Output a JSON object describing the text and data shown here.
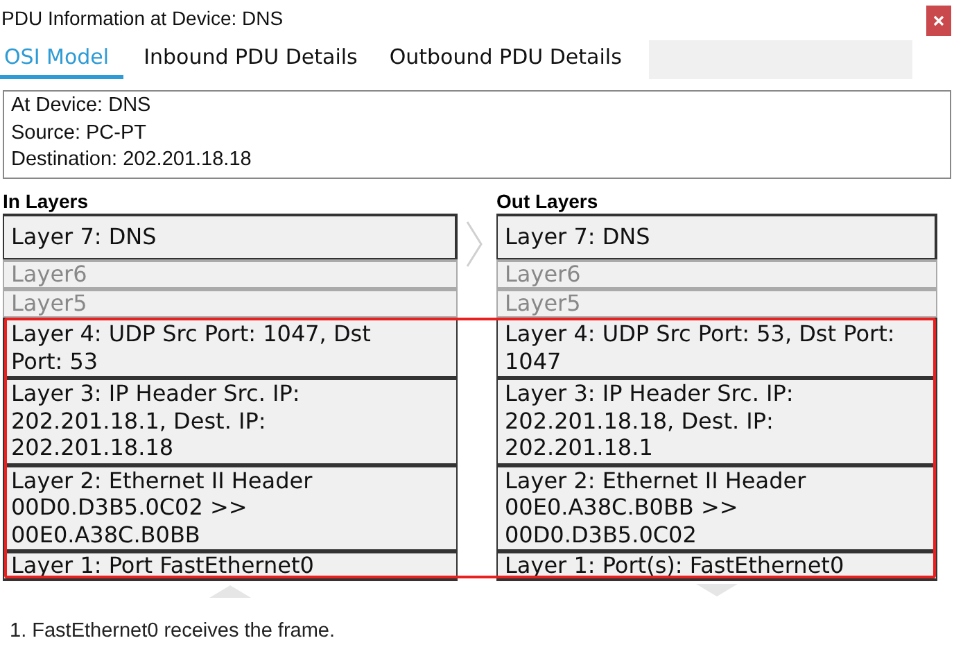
{
  "window": {
    "title": "PDU Information at Device: DNS"
  },
  "tabs": [
    {
      "label": "OSI Model",
      "selected": true
    },
    {
      "label": "Inbound PDU Details",
      "selected": false
    },
    {
      "label": "Outbound PDU Details",
      "selected": false
    }
  ],
  "info": [
    "At Device: DNS",
    "Source: PC-PT",
    "Destination: 202.201.18.18"
  ],
  "in_layers": {
    "heading": "In Layers",
    "layers": [
      {
        "text": "Layer 7: DNS",
        "disabled": false
      },
      {
        "text": "Layer6",
        "disabled": true
      },
      {
        "text": "Layer5",
        "disabled": true
      },
      {
        "text": "Layer 4: UDP Src Port: 1047, Dst Port: 53",
        "disabled": false
      },
      {
        "text": "Layer 3: IP Header Src. IP: 202.201.18.1, Dest. IP: 202.201.18.18",
        "disabled": false
      },
      {
        "text": "Layer 2: Ethernet II Header 00D0.D3B5.0C02 >> 00E0.A38C.B0BB",
        "disabled": false
      },
      {
        "text": "Layer 1: Port FastEthernet0",
        "disabled": false
      }
    ]
  },
  "out_layers": {
    "heading": "Out Layers",
    "layers": [
      {
        "text": "Layer 7: DNS",
        "disabled": false
      },
      {
        "text": "Layer6",
        "disabled": true
      },
      {
        "text": "Layer5",
        "disabled": true
      },
      {
        "text": "Layer 4: UDP Src Port: 53, Dst Port: 1047",
        "disabled": false
      },
      {
        "text": "Layer 3: IP Header Src. IP: 202.201.18.18, Dest. IP: 202.201.18.1",
        "disabled": false
      },
      {
        "text": "Layer 2: Ethernet II Header 00E0.A38C.B0BB >> 00D0.D3B5.0C02",
        "disabled": false
      },
      {
        "text": "Layer 1: Port(s): FastEthernet0",
        "disabled": false
      }
    ]
  },
  "steps": [
    "1. FastEthernet0 receives the frame."
  ]
}
